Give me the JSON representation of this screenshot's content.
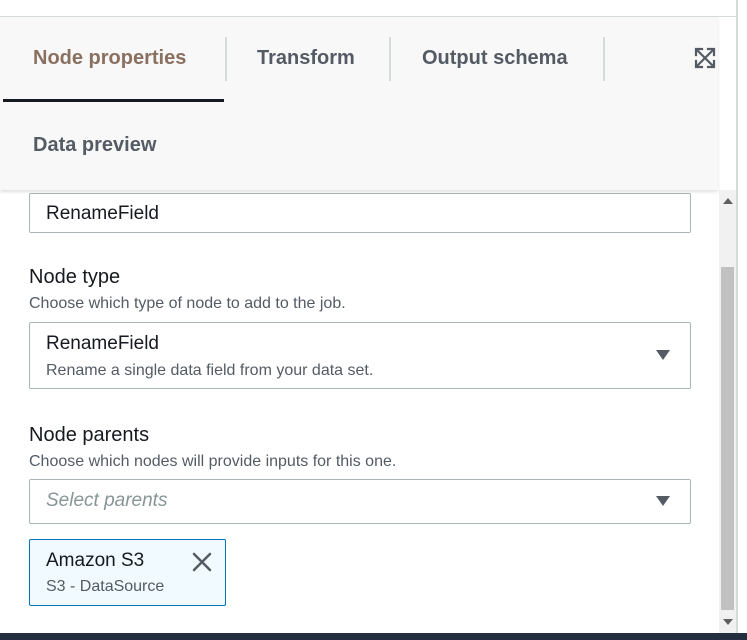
{
  "tabs": {
    "node_properties": "Node properties",
    "transform": "Transform",
    "output_schema": "Output schema",
    "data_preview": "Data preview",
    "active": "Node properties"
  },
  "icons": {
    "expand": "expand-icon",
    "dropdown": "caret-down-icon",
    "remove": "close-icon"
  },
  "form": {
    "name_value": "RenameField",
    "node_type": {
      "label": "Node type",
      "description": "Choose which type of node to add to the job.",
      "selected_title": "RenameField",
      "selected_description": "Rename a single data field from your data set."
    },
    "node_parents": {
      "label": "Node parents",
      "description": "Choose which nodes will provide inputs for this one.",
      "placeholder": "Select parents",
      "tokens": [
        {
          "title": "Amazon S3",
          "subtitle": "S3 - DataSource"
        }
      ]
    }
  },
  "colors": {
    "active_tab": "#8a7060",
    "token_border": "#0073bb",
    "token_bg": "#f1faff"
  }
}
